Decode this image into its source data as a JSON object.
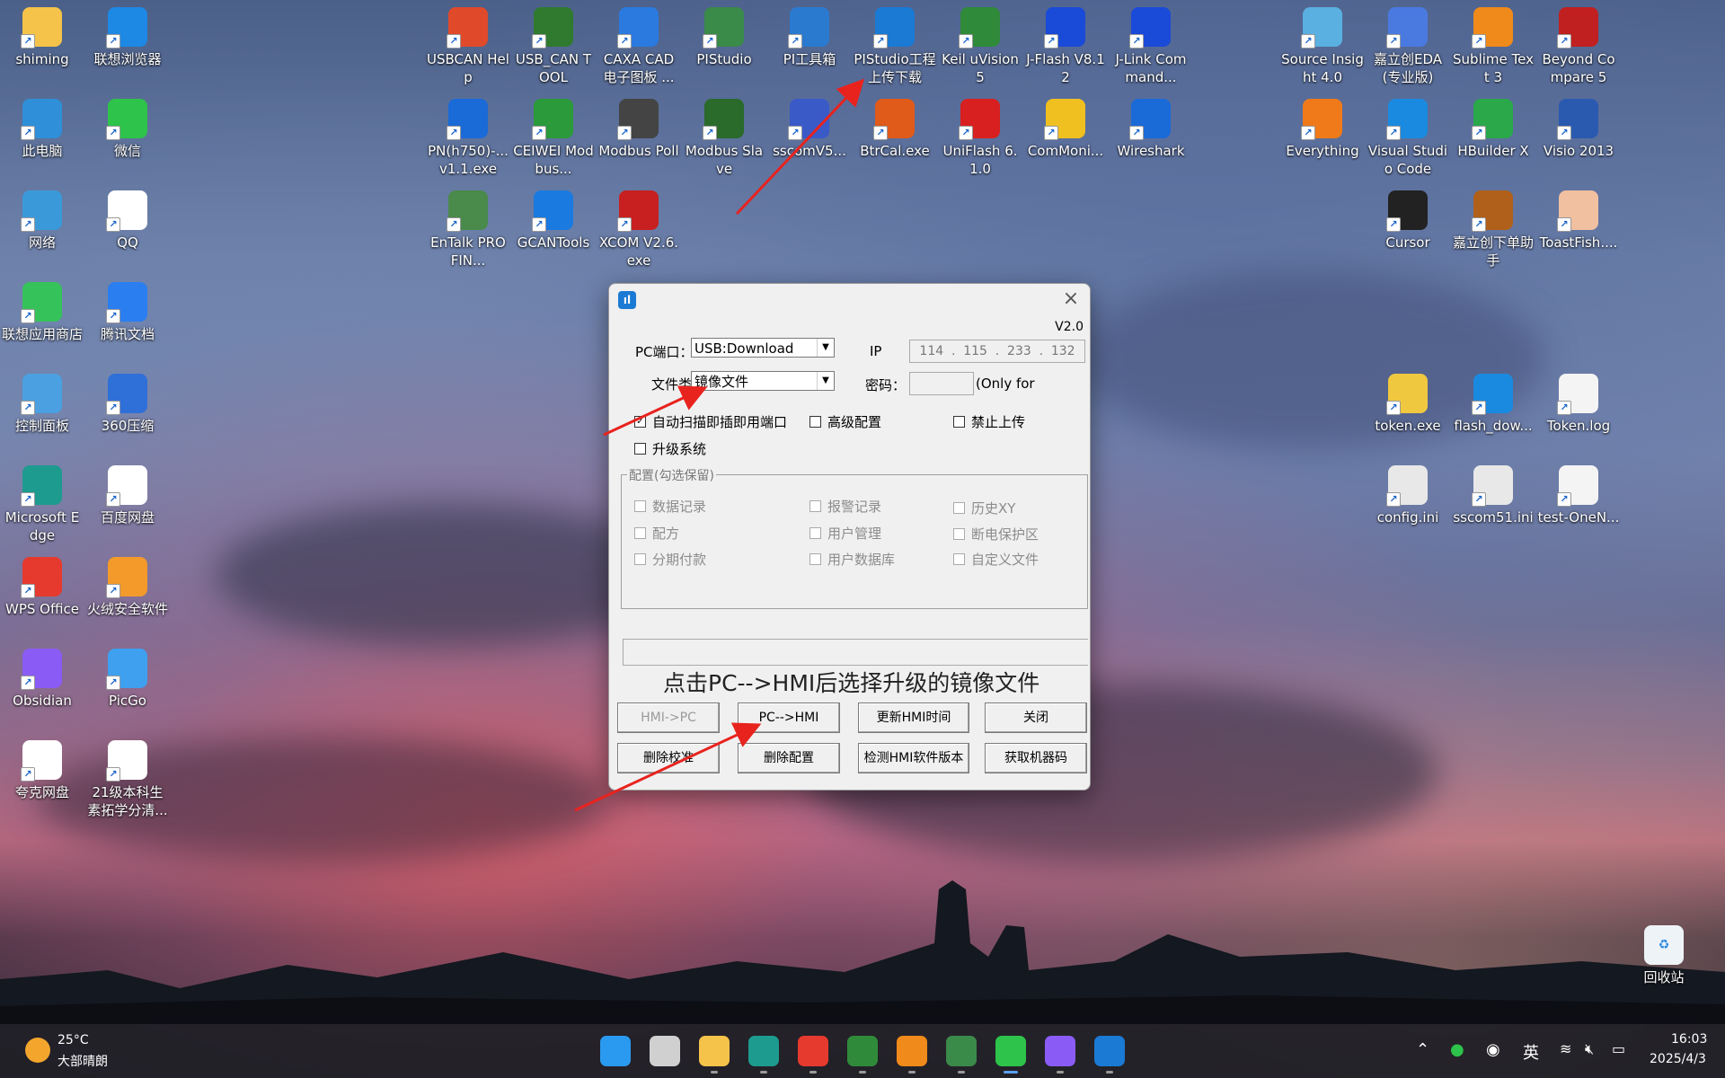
{
  "desktop": {
    "icons_left": [
      {
        "label": "shiming",
        "glyph": "folder-icon",
        "color": "#f5c34a"
      },
      {
        "label": "联想浏览器",
        "glyph": "browser-icon",
        "color": "#1e88e5"
      },
      {
        "label": "此电脑",
        "glyph": "computer-icon",
        "color": "#2f8fd8"
      },
      {
        "label": "微信",
        "glyph": "wechat-icon",
        "color": "#2ec34a"
      },
      {
        "label": "网络",
        "glyph": "network-icon",
        "color": "#3a9ad9"
      },
      {
        "label": "QQ",
        "glyph": "qq-icon",
        "color": "#ffffff"
      },
      {
        "label": "联想应用商店",
        "glyph": "store-icon",
        "color": "#36c25a"
      },
      {
        "label": "腾讯文档",
        "glyph": "docs-icon",
        "color": "#2a7ef0"
      },
      {
        "label": "控制面板",
        "glyph": "control-panel-icon",
        "color": "#4aa0e0"
      },
      {
        "label": "360压缩",
        "glyph": "zip-icon",
        "color": "#2f6fd8"
      },
      {
        "label": "Microsoft Edge",
        "glyph": "edge-icon",
        "color": "#1d9b8f"
      },
      {
        "label": "百度网盘",
        "glyph": "cloud-drive-icon",
        "color": "#ffffff"
      },
      {
        "label": "WPS Office",
        "glyph": "wps-icon",
        "color": "#e63a2e"
      },
      {
        "label": "火绒安全软件",
        "glyph": "shield-icon",
        "color": "#f39a2b"
      },
      {
        "label": "Obsidian",
        "glyph": "obsidian-icon",
        "color": "#8a5cf5"
      },
      {
        "label": "PicGo",
        "glyph": "picgo-icon",
        "color": "#3fa0f0"
      },
      {
        "label": "夸克网盘",
        "glyph": "cloud-icon",
        "color": "#ffffff"
      },
      {
        "label": "21级本科生素拓学分清...",
        "glyph": "sheet-icon",
        "color": "#ffffff"
      }
    ],
    "icons_top": [
      {
        "label": "USBCAN Help",
        "glyph": "help-file-icon",
        "color": "#e04a2a"
      },
      {
        "label": "USB_CAN TOOL",
        "glyph": "can-tool-icon",
        "color": "#2f7a2f"
      },
      {
        "label": "CAXA CAD 电子图板 ...",
        "glyph": "cad-icon",
        "color": "#2a7ae0"
      },
      {
        "label": "PIStudio",
        "glyph": "pistudio-icon",
        "color": "#3a8a4a"
      },
      {
        "label": "PI工具箱",
        "glyph": "toolbox-icon",
        "color": "#2a7ad0"
      },
      {
        "label": "PIStudio工程上传下载",
        "glyph": "upload-download-icon",
        "color": "#1a7ad4"
      },
      {
        "label": "Keil uVision5",
        "glyph": "keil-icon",
        "color": "#2f8a3a"
      },
      {
        "label": "J-Flash V8.12",
        "glyph": "jflash-icon",
        "color": "#1a4ad8"
      },
      {
        "label": "J-Link Command...",
        "glyph": "jlink-icon",
        "color": "#1a4ad8"
      },
      {
        "label": "PN(h750)-... v1.1.exe",
        "glyph": "exe-icon",
        "color": "#1a6ad8"
      },
      {
        "label": "CEIWEI Modbus...",
        "glyph": "modbus-icon",
        "color": "#2a9a3a"
      },
      {
        "label": "Modbus Poll",
        "glyph": "modbus-poll-icon",
        "color": "#444444"
      },
      {
        "label": "Modbus Slave",
        "glyph": "modbus-slave-icon",
        "color": "#2a6a2a"
      },
      {
        "label": "sscomV5...",
        "glyph": "serial-icon",
        "color": "#3a5ac8"
      },
      {
        "label": "BtrCal.exe",
        "glyph": "calc-icon",
        "color": "#e05a1a"
      },
      {
        "label": "UniFlash 6.1.0",
        "glyph": "uniflash-icon",
        "color": "#d82020"
      },
      {
        "label": "ComMoni...",
        "glyph": "duck-icon",
        "color": "#f0c020"
      },
      {
        "label": "Wireshark",
        "glyph": "wireshark-icon",
        "color": "#1a6ad8"
      },
      {
        "label": "EnTalk PROFIN...",
        "glyph": "entalk-icon",
        "color": "#4a8a4a"
      },
      {
        "label": "GCANTools",
        "glyph": "gcan-icon",
        "color": "#1a7ae0"
      },
      {
        "label": "XCOM V2.6.exe",
        "glyph": "xcom-icon",
        "color": "#c82020"
      }
    ],
    "icons_right": [
      {
        "label": "Source Insight 4.0",
        "glyph": "source-insight-icon",
        "color": "#5ab0e0"
      },
      {
        "label": "嘉立创EDA(专业版)",
        "glyph": "eda-icon",
        "color": "#4a7ae0"
      },
      {
        "label": "Sublime Text 3",
        "glyph": "sublime-icon",
        "color": "#f08a1a"
      },
      {
        "label": "Beyond Compare 5",
        "glyph": "compare-icon",
        "color": "#c02020"
      },
      {
        "label": "Everything",
        "glyph": "search-icon",
        "color": "#f07a1a"
      },
      {
        "label": "Visual Studio Code",
        "glyph": "vscode-icon",
        "color": "#1a8ae0"
      },
      {
        "label": "HBuilder X",
        "glyph": "hbuilder-icon",
        "color": "#2aa84a"
      },
      {
        "label": "Visio 2013",
        "glyph": "visio-icon",
        "color": "#2a5ab0"
      },
      {
        "label": "Cursor",
        "glyph": "cursor-app-icon",
        "color": "#222222"
      },
      {
        "label": "嘉立创下单助手",
        "glyph": "bear-icon",
        "color": "#b0601a"
      },
      {
        "label": "ToastFish....",
        "glyph": "toastfish-icon",
        "color": "#f0c0a0"
      },
      {
        "label": "token.exe",
        "glyph": "token-exe-icon",
        "color": "#f0c840"
      },
      {
        "label": "flash_dow...",
        "glyph": "gear-icon",
        "color": "#1a8ae0"
      },
      {
        "label": "Token.log",
        "glyph": "log-file-icon",
        "color": "#f4f4f4"
      },
      {
        "label": "config.ini",
        "glyph": "ini-file-icon",
        "color": "#e8e8e8"
      },
      {
        "label": "sscom51.ini",
        "glyph": "ini-file-icon",
        "color": "#e8e8e8"
      },
      {
        "label": "test-OneN...",
        "glyph": "text-file-icon",
        "color": "#f4f4f4"
      }
    ],
    "recycle_bin": {
      "label": "回收站",
      "glyph": "recycle-bin-icon"
    }
  },
  "dialog": {
    "version": "V2.0",
    "pc_port_label": "PC端口：",
    "pc_port_value": "USB:Download",
    "ip_label": "IP",
    "ip_octets": [
      "114",
      "115",
      "233",
      "132"
    ],
    "file_type_label": "文件类",
    "file_type_value": "镜像文件",
    "password_label": "密码：",
    "password_note": "(Only for",
    "checkboxes": [
      {
        "label": "自动扫描即插即用端口",
        "checked": true
      },
      {
        "label": "高级配置",
        "checked": false
      },
      {
        "label": "禁止上传",
        "checked": false
      },
      {
        "label": "升级系统",
        "checked": false
      }
    ],
    "config_group_title": "配置(勾选保留)",
    "config_items": [
      "数据记录",
      "报警记录",
      "历史XY",
      "配方",
      "用户管理",
      "断电保护区",
      "分期付款",
      "用户数据库",
      "自定义文件"
    ],
    "hint_text": "点击PC-->HMI后选择升级的镜像文件",
    "buttons_row1": [
      "HMI->PC",
      "PC-->HMI",
      "更新HMI时间",
      "关闭"
    ],
    "buttons_row2": [
      "删除校准",
      "删除配置",
      "检测HMI软件版本",
      "获取机器码"
    ]
  },
  "taskbar": {
    "weather_temp": "25°C",
    "weather_desc": "大部晴朗",
    "ime": "英",
    "time": "16:03",
    "date": "2025/4/3",
    "pinned": [
      {
        "name": "start-icon",
        "color": "#2a9af0"
      },
      {
        "name": "task-view-icon",
        "color": "#d0d0d0"
      },
      {
        "name": "file-explorer-icon",
        "color": "#f5c34a"
      },
      {
        "name": "edge-icon",
        "color": "#1d9b8f"
      },
      {
        "name": "wps-icon",
        "color": "#e63a2e"
      },
      {
        "name": "keil-icon",
        "color": "#2f8a3a"
      },
      {
        "name": "sublime-icon",
        "color": "#f08a1a"
      },
      {
        "name": "pistudio-icon",
        "color": "#3a8a4a"
      },
      {
        "name": "wechat-icon",
        "color": "#2ec34a"
      },
      {
        "name": "obsidian-icon",
        "color": "#8a5cf5"
      },
      {
        "name": "upload-download-icon",
        "color": "#1a7ad4"
      }
    ]
  }
}
